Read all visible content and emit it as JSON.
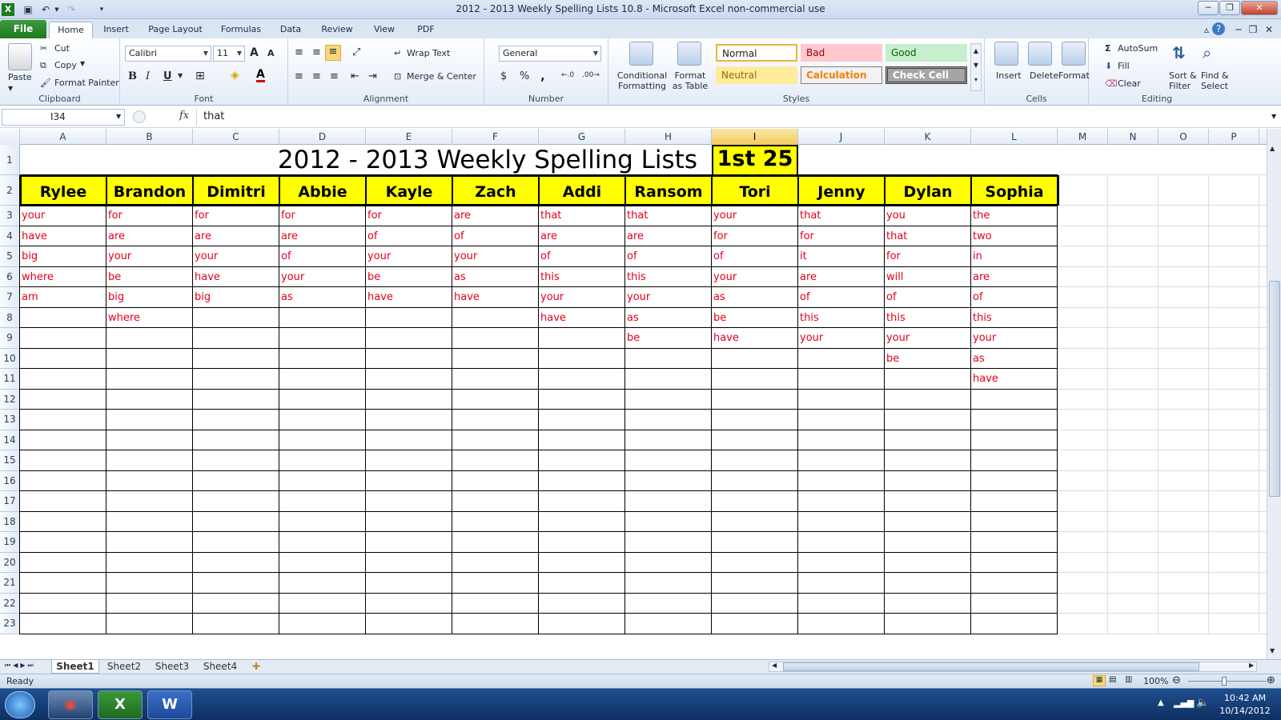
{
  "window": {
    "title": "2012 - 2013 Weekly Spelling Lists 10.8  -  Microsoft Excel non-commercial use"
  },
  "tabs": [
    "Home",
    "Insert",
    "Page Layout",
    "Formulas",
    "Data",
    "Review",
    "View",
    "PDF"
  ],
  "file_tab": "File",
  "ribbon": {
    "clipboard": {
      "label": "Clipboard",
      "paste": "Paste",
      "cut": "Cut",
      "copy": "Copy",
      "format_painter": "Format Painter"
    },
    "font": {
      "label": "Font",
      "family": "Calibri",
      "size": "11",
      "bold": "B",
      "italic": "I",
      "underline": "U",
      "grow": "A",
      "shrink": "A",
      "font_color": "A"
    },
    "alignment": {
      "label": "Alignment",
      "wrap_text": "Wrap Text",
      "merge_center": "Merge & Center"
    },
    "number": {
      "label": "Number",
      "format": "General",
      "currency": "$",
      "percent": "%",
      "comma": ","
    },
    "styles": {
      "label": "Styles",
      "conditional_l1": "Conditional",
      "conditional_l2": "Formatting",
      "table_l1": "Format",
      "table_l2": "as Table",
      "normal": "Normal",
      "bad": "Bad",
      "good": "Good",
      "neutral": "Neutral",
      "calculation": "Calculation",
      "check_cell": "Check Cell"
    },
    "cells": {
      "label": "Cells",
      "insert": "Insert",
      "delete": "Delete",
      "format": "Format"
    },
    "editing": {
      "label": "Editing",
      "autosum": "AutoSum",
      "fill": "Fill",
      "clear": "Clear",
      "sort_l1": "Sort &",
      "sort_l2": "Filter",
      "find_l1": "Find &",
      "find_l2": "Select"
    }
  },
  "formula_bar": {
    "name_box": "I34",
    "fx": "fx",
    "value": "that"
  },
  "columns": [
    "A",
    "B",
    "C",
    "D",
    "E",
    "F",
    "G",
    "H",
    "I",
    "J",
    "K",
    "L",
    "M",
    "N",
    "O",
    "P"
  ],
  "rows": [
    "1",
    "2",
    "3",
    "4",
    "5",
    "6",
    "7",
    "8",
    "9",
    "10",
    "11",
    "12",
    "13",
    "14",
    "15",
    "16",
    "17",
    "18",
    "19",
    "20",
    "21",
    "22",
    "23"
  ],
  "sheet": {
    "title": "2012 - 2013 Weekly Spelling Lists",
    "tag": "1st 25",
    "students": [
      {
        "name": "Rylee",
        "words": [
          "your",
          "have",
          "big",
          "where",
          "am"
        ]
      },
      {
        "name": "Brandon",
        "words": [
          "for",
          "are",
          "your",
          "be",
          "big",
          "where"
        ]
      },
      {
        "name": "Dimitri",
        "words": [
          "for",
          "are",
          "your",
          "have",
          "big"
        ]
      },
      {
        "name": "Abbie",
        "words": [
          "for",
          "are",
          "of",
          "your",
          "as"
        ]
      },
      {
        "name": "Kayle",
        "words": [
          "for",
          "of",
          "your",
          "be",
          "have"
        ]
      },
      {
        "name": "Zach",
        "words": [
          "are",
          "of",
          "your",
          "as",
          "have"
        ]
      },
      {
        "name": "Addi",
        "words": [
          "that",
          "are",
          "of",
          "this",
          "your",
          "have"
        ]
      },
      {
        "name": "Ransom",
        "words": [
          "that",
          "are",
          "of",
          "this",
          "your",
          "as",
          "be"
        ]
      },
      {
        "name": "Tori",
        "words": [
          "your",
          "for",
          "of",
          "your",
          "as",
          "be",
          "have"
        ]
      },
      {
        "name": "Jenny",
        "words": [
          "that",
          "for",
          "it",
          "are",
          "of",
          "this",
          "your"
        ]
      },
      {
        "name": "Dylan",
        "words": [
          "you",
          "that",
          "for",
          "will",
          "of",
          "this",
          "your",
          "be"
        ]
      },
      {
        "name": "Sophia",
        "words": [
          "the",
          "two",
          "in",
          "are",
          "of",
          "this",
          "your",
          "as",
          "have"
        ]
      }
    ]
  },
  "sheet_tabs": [
    "Sheet1",
    "Sheet2",
    "Sheet3",
    "Sheet4"
  ],
  "status": {
    "ready": "Ready",
    "zoom": "100%"
  },
  "taskbar": {
    "time": "10:42 AM",
    "date": "10/14/2012"
  },
  "colors": {
    "header_fill": "#ffff00",
    "word_color": "#e3001a",
    "file_tab": "#1e7a1f"
  }
}
